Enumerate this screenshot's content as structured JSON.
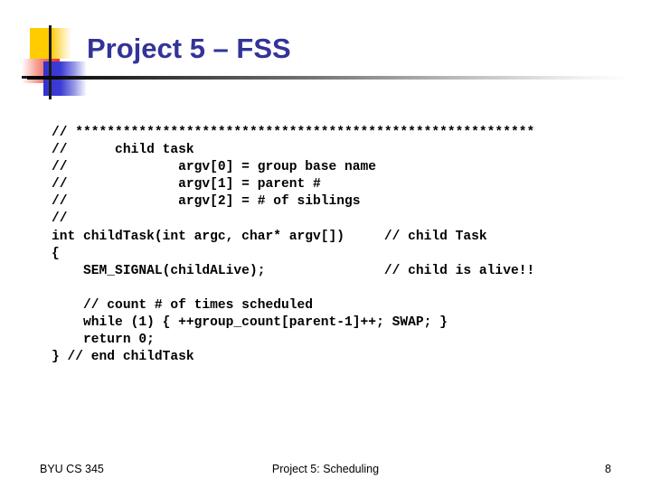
{
  "slide": {
    "title": "Project 5 – FSS",
    "title_color": "#333399",
    "background_color": "#ffffff",
    "divider_color_start": "#000000",
    "divider_color_end": "#ffffff"
  },
  "logo": {
    "name": "powerpoint-design-logo",
    "yellow_color": "#ffcc00",
    "red_color": "#ef4136",
    "blue_color": "#3333cc",
    "rule_color": "#1a1a1a"
  },
  "code": {
    "language": "c",
    "lines": [
      "// **********************************************************",
      "//      child task",
      "//              argv[0] = group base name",
      "//              argv[1] = parent #",
      "//              argv[2] = # of siblings",
      "//",
      "int childTask(int argc, char* argv[])     // child Task",
      "{",
      "    SEM_SIGNAL(childALive);               // child is alive!!",
      "",
      "    // count # of times scheduled",
      "    while (1) { ++group_count[parent-1]++; SWAP; }",
      "    return 0;",
      "} // end childTask"
    ]
  },
  "footer": {
    "left": "BYU CS 345",
    "center": "Project 5: Scheduling",
    "page_number": "8"
  }
}
